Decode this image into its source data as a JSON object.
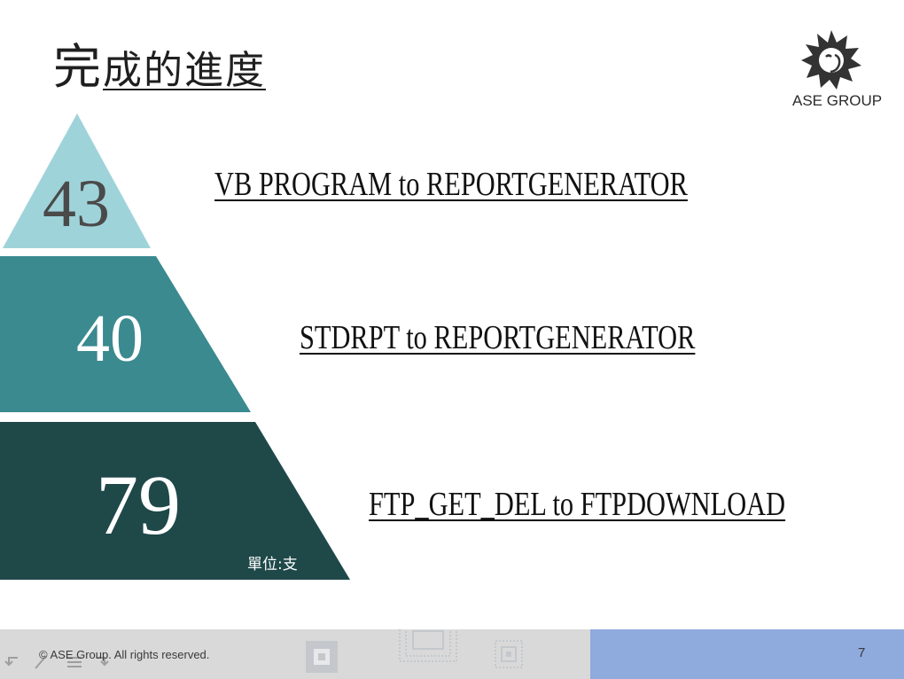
{
  "slide": {
    "title_first": "完",
    "title_rest": "成的進度",
    "logo_text": "ASE GROUP",
    "unit_label": "單位:支",
    "page_number": "7",
    "copyright": "© ASE Group. All rights reserved."
  },
  "tiers": [
    {
      "value": "43",
      "label": "VB PROGRAM to REPORTGENERATOR",
      "color": "#9fd3da"
    },
    {
      "value": "40",
      "label": "STDRPT to REPORTGENERATOR",
      "color": "#3a8a8f"
    },
    {
      "value": "79",
      "label": "FTP_GET_DEL to FTPDOWNLOAD",
      "color": "#1f4849"
    }
  ],
  "footer": {
    "left_color": "#d9d9d9",
    "right_color": "#8faadc"
  },
  "icons": [
    "ase-logo-icon",
    "back-arrow-icon",
    "pen-icon",
    "menu-icon",
    "forward-arrow-icon"
  ]
}
